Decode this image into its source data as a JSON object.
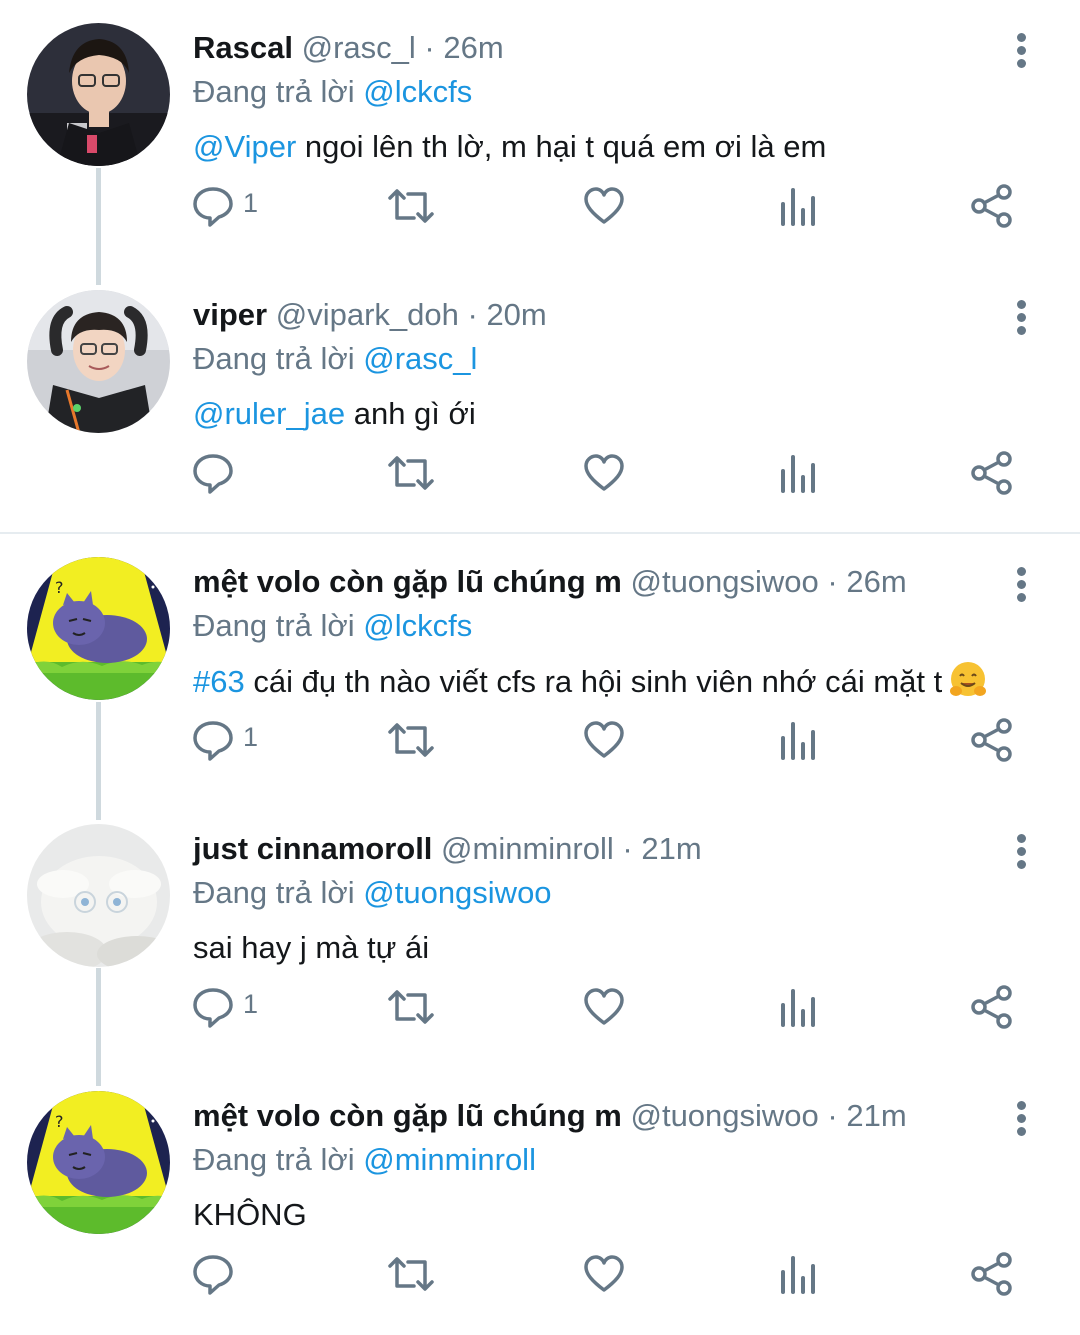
{
  "replying_prefix": "Đang trả lời",
  "colors": {
    "accent": "#1b95e0",
    "secondary": "#657786",
    "thread_line": "#cfd9de"
  },
  "tweets": [
    {
      "name": "Rascal",
      "handle": "@rasc_l",
      "sep": "·",
      "time": "26m",
      "replying_to": "@lckcfs",
      "body_mention": "@Viper",
      "body_text": " ngoi lên th lờ, m hại t quá em ơi là em",
      "reply_count": "1",
      "avatar_icon": "person-avatar"
    },
    {
      "name": "viper",
      "handle": "@vipark_doh",
      "sep": "·",
      "time": "20m",
      "replying_to": "@rasc_l",
      "body_mention": "@ruler_jae",
      "body_text": " anh gì ới",
      "reply_count": "",
      "avatar_icon": "person-avatar"
    },
    {
      "name": "mệt volo còn gặp lũ chúng m",
      "handle": "@tuongsiwoo",
      "sep": "·",
      "time": "26m",
      "replying_to": "@lckcfs",
      "body_mention": "#63",
      "body_text": " cái đụ th nào viết cfs ra hội sinh viên nhớ cái mặt t",
      "body_emoji": "hugging-face-emoji",
      "reply_count": "1",
      "avatar_icon": "cartoon-cat-avatar"
    },
    {
      "name": "just cinnamoroll",
      "handle": "@minminroll",
      "sep": "·",
      "time": "21m",
      "replying_to": "@tuongsiwoo",
      "body_mention": "",
      "body_text": "sai hay j mà tự ái",
      "reply_count": "1",
      "avatar_icon": "plush-toy-avatar"
    },
    {
      "name": "mệt volo còn gặp lũ chúng m",
      "handle": "@tuongsiwoo",
      "sep": "·",
      "time": "21m",
      "replying_to": "@minminroll",
      "body_mention": "",
      "body_text": "KHÔNG",
      "reply_count": "",
      "avatar_icon": "cartoon-cat-avatar"
    }
  ]
}
